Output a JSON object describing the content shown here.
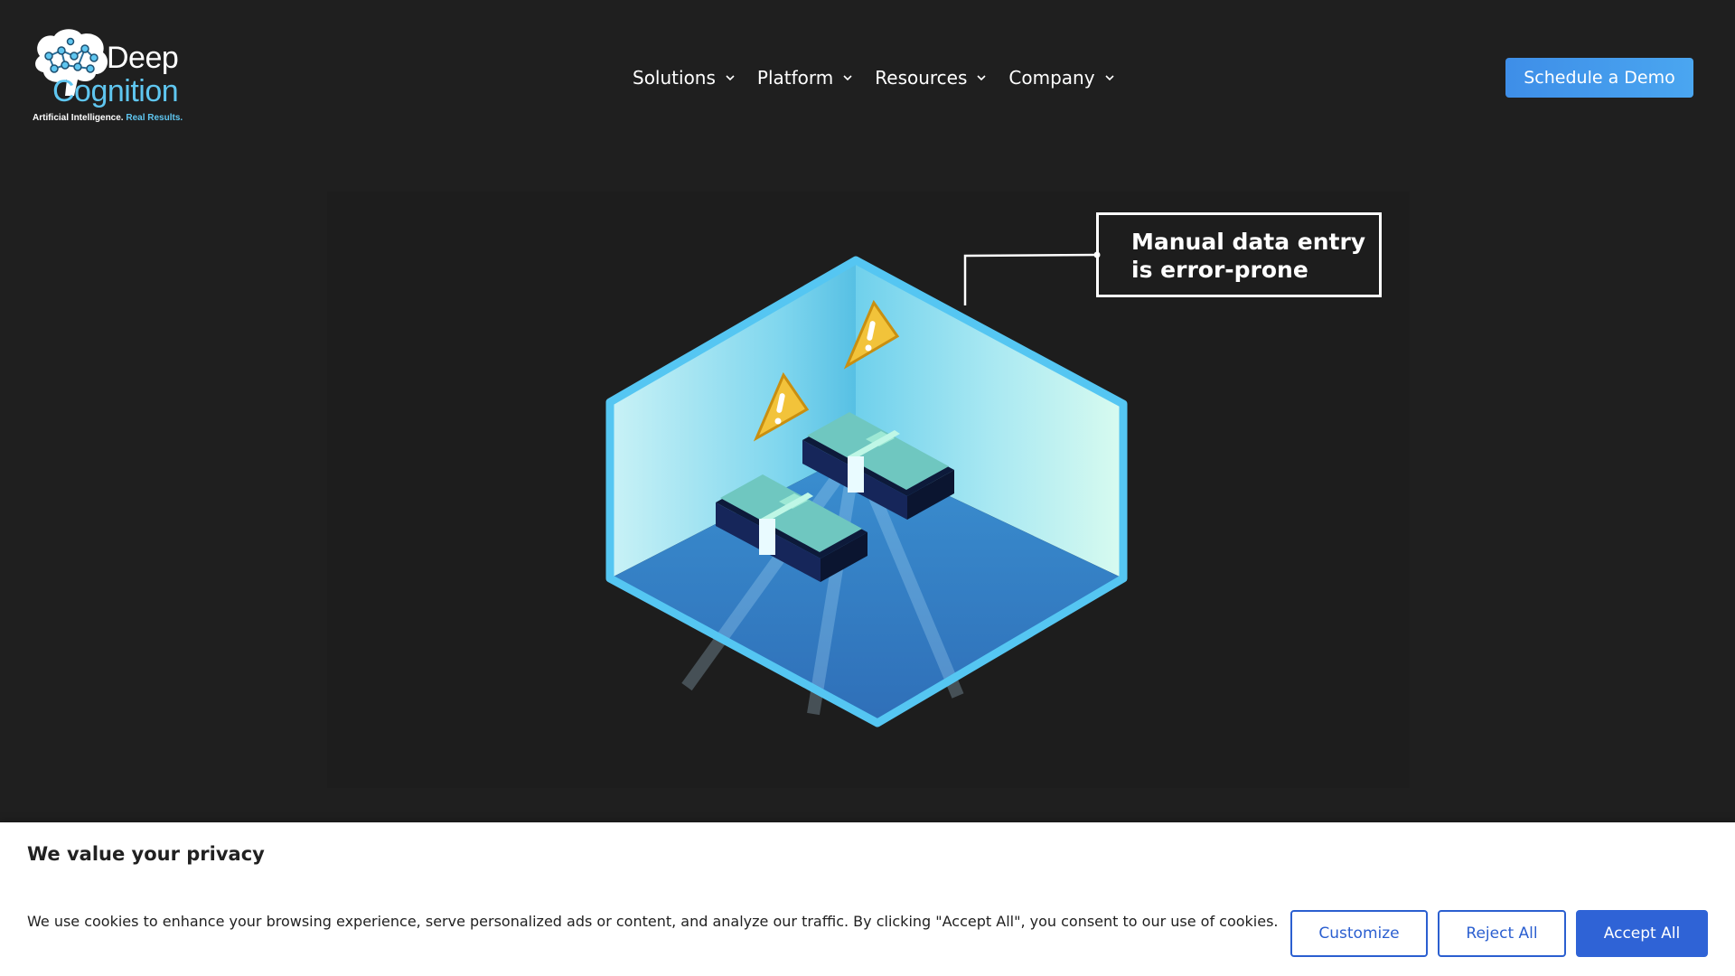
{
  "header": {
    "logo": {
      "word1": "Deep",
      "word2": "Cognition",
      "tagline_main": "Artificial Intelligence.",
      "tagline_accent": "Real Results."
    },
    "nav": [
      {
        "label": "Solutions",
        "icon": "chevron-down-icon"
      },
      {
        "label": "Platform",
        "icon": "chevron-down-icon"
      },
      {
        "label": "Resources",
        "icon": "chevron-down-icon"
      },
      {
        "label": "Company",
        "icon": "chevron-down-icon"
      }
    ],
    "cta_label": "Schedule a Demo"
  },
  "hero": {
    "callout_line1": "Manual data entry",
    "callout_line2": "is error-prone",
    "icons": [
      "warning-icon",
      "warning-icon",
      "money-stack-icon",
      "money-stack-icon"
    ]
  },
  "cookie_banner": {
    "title": "We value your privacy",
    "text": "We use cookies to enhance your browsing experience, serve personalized ads or content, and analyze our traffic. By clicking \"Accept All\", you consent to our use of cookies.",
    "customize_label": "Customize",
    "reject_label": "Reject All",
    "accept_label": "Accept All"
  },
  "colors": {
    "background": "#1f1f1f",
    "brand_accent": "#5fc6f0",
    "cta": "#3e8ee8",
    "cookie_button": "#2f63d6"
  }
}
